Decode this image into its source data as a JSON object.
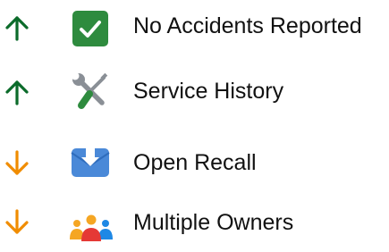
{
  "colors": {
    "positive": "#0b6b2a",
    "negative": "#f08c00",
    "check_box": "#2e8b3e",
    "recall_blue": "#4a89d8",
    "owner_orange": "#f5a623",
    "owner_red": "#e53935",
    "owner_blue": "#1e88e5"
  },
  "history_items": [
    {
      "label": "No Accidents Reported",
      "trend": "up",
      "trend_icon": "arrow-up-icon",
      "icon": "checkmark-box-icon"
    },
    {
      "label": "Service History",
      "trend": "up",
      "trend_icon": "arrow-up-icon",
      "icon": "wrench-screwdriver-icon"
    },
    {
      "label": "Open Recall",
      "trend": "down",
      "trend_icon": "arrow-down-icon",
      "icon": "recall-envelope-icon"
    },
    {
      "label": "Multiple Owners",
      "trend": "down",
      "trend_icon": "arrow-down-icon",
      "icon": "owners-group-icon"
    }
  ]
}
